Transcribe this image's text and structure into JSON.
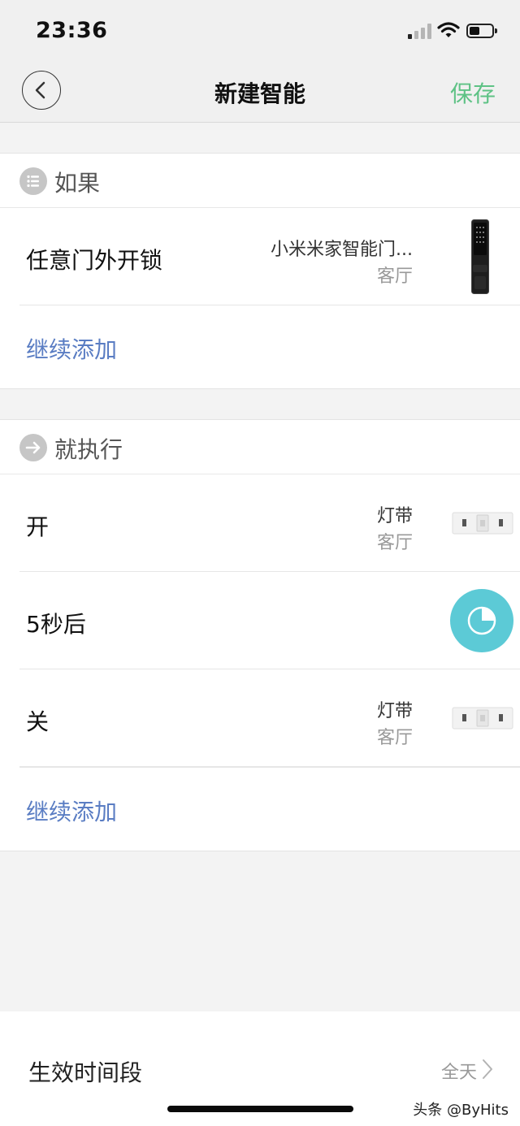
{
  "status": {
    "time": "23:36"
  },
  "nav": {
    "title": "新建智能",
    "save_label": "保存"
  },
  "if_section": {
    "label": "如果",
    "items": [
      {
        "title": "任意门外开锁",
        "device": "小米米家智能门...",
        "room": "客厅"
      }
    ],
    "add_label": "继续添加"
  },
  "then_section": {
    "label": "就执行",
    "items": [
      {
        "title": "开",
        "device": "灯带",
        "room": "客厅"
      },
      {
        "title": "5秒后"
      },
      {
        "title": "关",
        "device": "灯带",
        "room": "客厅"
      }
    ],
    "add_label": "继续添加"
  },
  "effective_period": {
    "label": "生效时间段",
    "value": "全天"
  },
  "watermark": "头条 @ByHits",
  "colors": {
    "accent_green": "#5ec285",
    "link_blue": "#5a7dc3",
    "timer_cyan": "#5ccad6"
  }
}
